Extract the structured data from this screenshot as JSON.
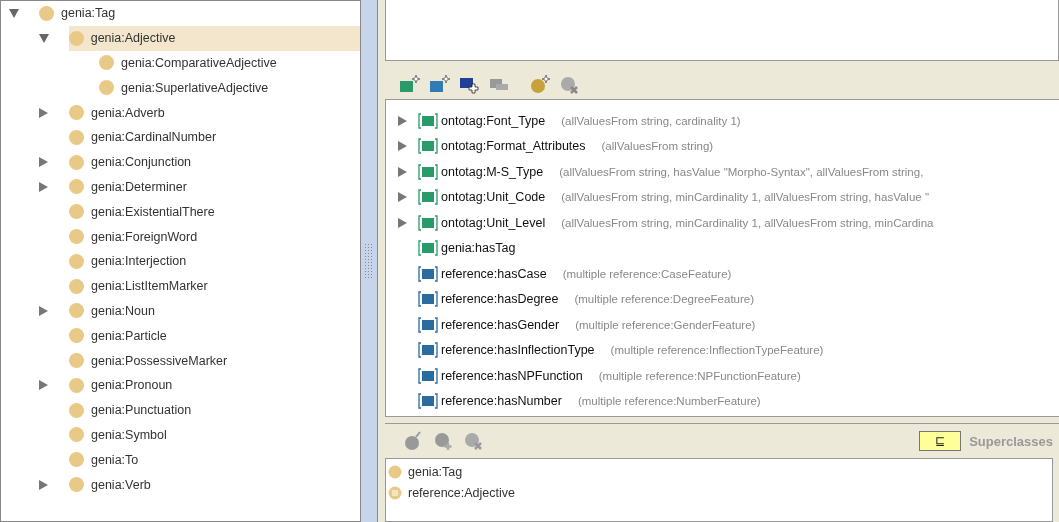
{
  "class_tree": [
    {
      "label": "genia:Tag",
      "selected": false,
      "expanded": true,
      "children": [
        {
          "label": "genia:Adjective",
          "selected": true,
          "expanded": true,
          "children": [
            {
              "label": "genia:ComparativeAdjective",
              "selected": false
            },
            {
              "label": "genia:SuperlativeAdjective",
              "selected": false
            }
          ]
        },
        {
          "label": "genia:Adverb",
          "selected": false,
          "expanded": false
        },
        {
          "label": "genia:CardinalNumber",
          "selected": false
        },
        {
          "label": "genia:Conjunction",
          "selected": false,
          "expanded": false
        },
        {
          "label": "genia:Determiner",
          "selected": false,
          "expanded": false
        },
        {
          "label": "genia:ExistentialThere",
          "selected": false
        },
        {
          "label": "genia:ForeignWord",
          "selected": false
        },
        {
          "label": "genia:Interjection",
          "selected": false
        },
        {
          "label": "genia:ListItemMarker",
          "selected": false
        },
        {
          "label": "genia:Noun",
          "selected": false,
          "expanded": false
        },
        {
          "label": "genia:Particle",
          "selected": false
        },
        {
          "label": "genia:PossessiveMarker",
          "selected": false
        },
        {
          "label": "genia:Pronoun",
          "selected": false,
          "expanded": false
        },
        {
          "label": "genia:Punctuation",
          "selected": false
        },
        {
          "label": "genia:Symbol",
          "selected": false
        },
        {
          "label": "genia:To",
          "selected": false
        },
        {
          "label": "genia:Verb",
          "selected": false,
          "expanded": false
        }
      ]
    }
  ],
  "properties": [
    {
      "kind": "datatype",
      "name": "ontotag:Font_Type",
      "restriction": "(allValuesFrom string,  cardinality 1)",
      "expanded": false
    },
    {
      "kind": "datatype",
      "name": "ontotag:Format_Attributes",
      "restriction": "(allValuesFrom string)",
      "expanded": false
    },
    {
      "kind": "datatype",
      "name": "ontotag:M-S_Type",
      "restriction": "(allValuesFrom string,  hasValue \"Morpho-Syntax\",  allValuesFrom string,",
      "expanded": false
    },
    {
      "kind": "datatype",
      "name": "ontotag:Unit_Code",
      "restriction": "(allValuesFrom string,  minCardinality 1,  allValuesFrom string,  hasValue \"",
      "expanded": false
    },
    {
      "kind": "datatype",
      "name": "ontotag:Unit_Level",
      "restriction": "(allValuesFrom string,  minCardinality 1,  allValuesFrom string,  minCardina",
      "expanded": false
    },
    {
      "kind": "datatype",
      "name": "genia:hasTag"
    },
    {
      "kind": "object",
      "name": "reference:hasCase",
      "restriction": "(multiple reference:CaseFeature)"
    },
    {
      "kind": "object",
      "name": "reference:hasDegree",
      "restriction": "(multiple reference:DegreeFeature)"
    },
    {
      "kind": "object",
      "name": "reference:hasGender",
      "restriction": "(multiple reference:GenderFeature)"
    },
    {
      "kind": "object",
      "name": "reference:hasInflectionType",
      "restriction": "(multiple reference:InflectionTypeFeature)"
    },
    {
      "kind": "object",
      "name": "reference:hasNPFunction",
      "restriction": "(multiple reference:NPFunctionFeature)"
    },
    {
      "kind": "object",
      "name": "reference:hasNumber",
      "restriction": "(multiple reference:NumberFeature)"
    }
  ],
  "superclasses": {
    "mode_symbol": "⊑",
    "title": "Superclasses",
    "items": [
      {
        "kind": "named",
        "label": "genia:Tag"
      },
      {
        "kind": "defined",
        "label": "reference:Adjective"
      }
    ]
  }
}
